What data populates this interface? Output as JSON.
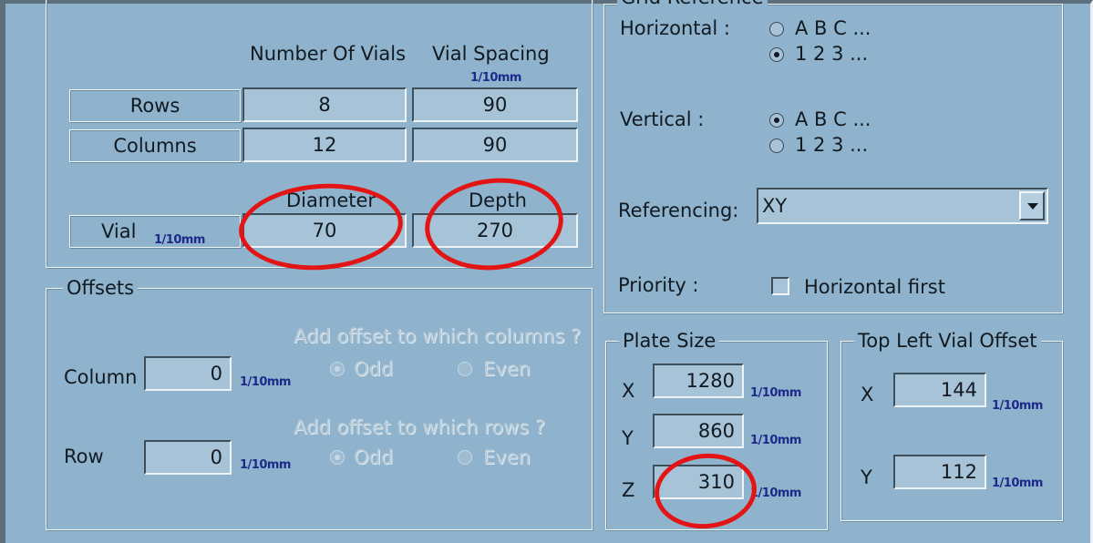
{
  "vial_layout": {
    "header_number_of_vials": "Number Of Vials",
    "header_vial_spacing": "Vial Spacing",
    "spacing_unit": "1/10mm",
    "rows_label": "Rows",
    "rows_count": "8",
    "rows_spacing": "90",
    "columns_label": "Columns",
    "columns_count": "12",
    "columns_spacing": "90",
    "diameter_label": "Diameter",
    "depth_label": "Depth",
    "vial_label": "Vial",
    "vial_unit": "1/10mm",
    "diameter_value": "70",
    "depth_value": "270"
  },
  "offsets": {
    "title": "Offsets",
    "columns_question": "Add offset to which columns ?",
    "rows_question": "Add offset to which rows ?",
    "column_label": "Column",
    "column_value": "0",
    "row_label": "Row",
    "row_value": "0",
    "unit": "1/10mm",
    "odd_label": "Odd",
    "even_label": "Even"
  },
  "grid_reference": {
    "title": "Grid Reference",
    "horizontal_label": "Horizontal :",
    "vertical_label": "Vertical :",
    "letters_option": "A  B  C ...",
    "numbers_option": "1  2  3 ...",
    "referencing_label": "Referencing:",
    "referencing_value": "XY",
    "priority_label": "Priority :",
    "horizontal_first_label": "Horizontal first"
  },
  "plate_size": {
    "title": "Plate Size",
    "x_label": "X",
    "x_value": "1280",
    "y_label": "Y",
    "y_value": "860",
    "z_label": "Z",
    "z_value": "310",
    "unit": "1/10mm"
  },
  "top_left_offset": {
    "title": "Top Left Vial Offset",
    "x_label": "X",
    "x_value": "144",
    "y_label": "Y",
    "y_value": "112",
    "unit": "1/10mm"
  },
  "annotation_color": "#e31414"
}
